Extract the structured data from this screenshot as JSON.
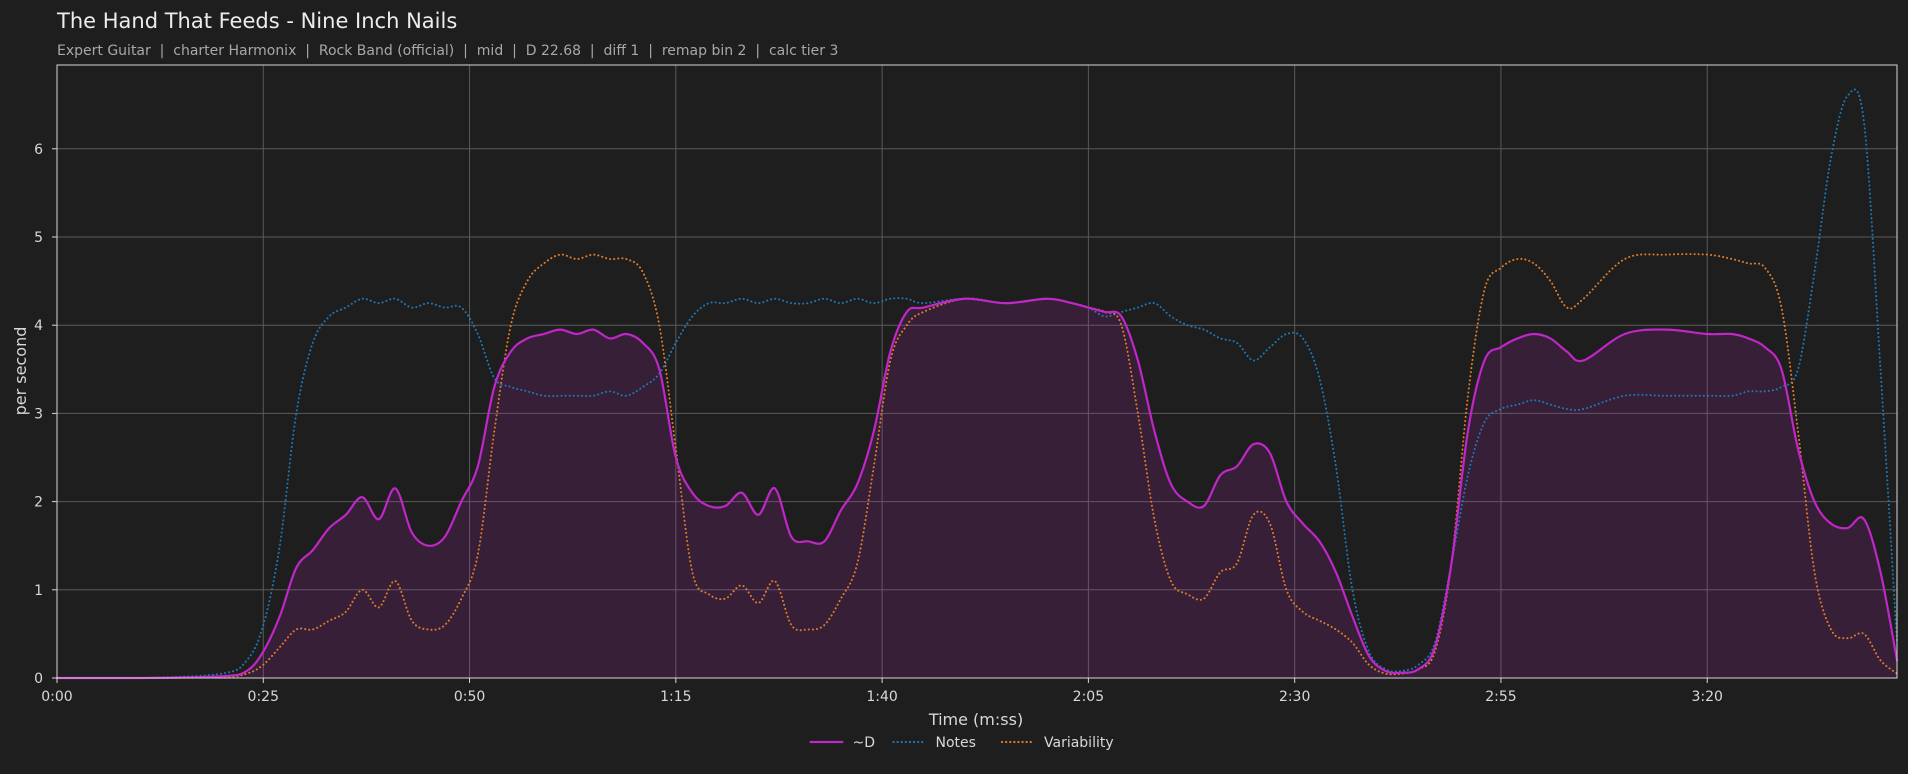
{
  "title": "The Hand That Feeds - Nine Inch Nails",
  "subtitle": "Expert Guitar  |  charter Harmonix  |  Rock Band (official)  |  mid  |  D 22.68  |  diff 1  |  remap bin 2  |  calc tier 3",
  "chart_data": {
    "type": "line",
    "title": "The Hand That Feeds - Nine Inch Nails",
    "xlabel": "Time (m:ss)",
    "ylabel": "per second",
    "xlim": [
      0,
      223
    ],
    "ylim": [
      0,
      6.95
    ],
    "grid": true,
    "legend": "bottom-center",
    "x_ticks": [
      0,
      25,
      50,
      75,
      100,
      125,
      150,
      175,
      200
    ],
    "x_tick_labels": [
      "0:00",
      "0:25",
      "0:50",
      "1:15",
      "1:40",
      "2:05",
      "2:30",
      "2:55",
      "3:20"
    ],
    "y_ticks": [
      0,
      1,
      2,
      3,
      4,
      5,
      6
    ],
    "y_tick_labels": [
      "0",
      "1",
      "2",
      "3",
      "4",
      "5",
      "6"
    ],
    "x": [
      0,
      10,
      20,
      23,
      25,
      27,
      29,
      31,
      33,
      35,
      37,
      39,
      41,
      43,
      45,
      47,
      49,
      51,
      53,
      55,
      57,
      59,
      61,
      63,
      65,
      67,
      69,
      71,
      73,
      75,
      77,
      79,
      81,
      83,
      85,
      87,
      89,
      91,
      93,
      95,
      97,
      99,
      101,
      103,
      105,
      110,
      115,
      120,
      123,
      125,
      127,
      129,
      131,
      133,
      135,
      137,
      139,
      141,
      143,
      145,
      147,
      149,
      151,
      153,
      155,
      157,
      159,
      161,
      163,
      165,
      167,
      169,
      171,
      173,
      175,
      177,
      179,
      181,
      183,
      185,
      190,
      195,
      200,
      203,
      205,
      207,
      209,
      211,
      213,
      215,
      217,
      219,
      221,
      223
    ],
    "series": [
      {
        "name": "~D",
        "color": "#c026c8",
        "style": "solid",
        "values": [
          0,
          0,
          0.02,
          0.08,
          0.3,
          0.7,
          1.25,
          1.45,
          1.7,
          1.85,
          2.05,
          1.8,
          2.15,
          1.65,
          1.5,
          1.6,
          2.0,
          2.4,
          3.3,
          3.7,
          3.85,
          3.9,
          3.95,
          3.9,
          3.95,
          3.85,
          3.9,
          3.8,
          3.5,
          2.5,
          2.1,
          1.95,
          1.95,
          2.1,
          1.85,
          2.15,
          1.6,
          1.55,
          1.55,
          1.9,
          2.2,
          2.8,
          3.7,
          4.15,
          4.2,
          4.3,
          4.25,
          4.3,
          4.25,
          4.2,
          4.15,
          4.1,
          3.6,
          2.8,
          2.2,
          2.0,
          1.95,
          2.3,
          2.4,
          2.65,
          2.55,
          2.0,
          1.75,
          1.55,
          1.2,
          0.7,
          0.25,
          0.08,
          0.06,
          0.1,
          0.35,
          1.3,
          2.8,
          3.6,
          3.75,
          3.85,
          3.9,
          3.85,
          3.7,
          3.6,
          3.9,
          3.95,
          3.9,
          3.9,
          3.85,
          3.75,
          3.5,
          2.6,
          2.0,
          1.75,
          1.7,
          1.8,
          1.2,
          0.2
        ]
      },
      {
        "name": "Notes",
        "color": "#1f77b4",
        "style": "dotted",
        "values": [
          0,
          0,
          0.05,
          0.2,
          0.6,
          1.5,
          3.0,
          3.8,
          4.1,
          4.2,
          4.3,
          4.25,
          4.3,
          4.2,
          4.25,
          4.2,
          4.2,
          3.9,
          3.4,
          3.3,
          3.25,
          3.2,
          3.2,
          3.2,
          3.2,
          3.25,
          3.2,
          3.3,
          3.45,
          3.8,
          4.1,
          4.25,
          4.25,
          4.3,
          4.25,
          4.3,
          4.25,
          4.25,
          4.3,
          4.25,
          4.3,
          4.25,
          4.3,
          4.3,
          4.25,
          4.3,
          4.25,
          4.3,
          4.25,
          4.2,
          4.1,
          4.15,
          4.2,
          4.25,
          4.1,
          4.0,
          3.95,
          3.85,
          3.8,
          3.6,
          3.75,
          3.9,
          3.85,
          3.4,
          2.4,
          1.0,
          0.3,
          0.1,
          0.08,
          0.15,
          0.4,
          1.3,
          2.3,
          2.9,
          3.05,
          3.1,
          3.15,
          3.1,
          3.05,
          3.05,
          3.2,
          3.2,
          3.2,
          3.2,
          3.25,
          3.25,
          3.3,
          3.5,
          4.6,
          5.9,
          6.6,
          6.3,
          3.5,
          0.4
        ]
      },
      {
        "name": "Variability",
        "color": "#e07b2a",
        "style": "dotted",
        "values": [
          0,
          0,
          0.01,
          0.05,
          0.15,
          0.35,
          0.55,
          0.55,
          0.65,
          0.75,
          1.0,
          0.8,
          1.1,
          0.65,
          0.55,
          0.6,
          0.9,
          1.4,
          2.8,
          4.0,
          4.5,
          4.7,
          4.8,
          4.75,
          4.8,
          4.75,
          4.75,
          4.6,
          4.0,
          2.6,
          1.2,
          0.95,
          0.9,
          1.05,
          0.85,
          1.1,
          0.6,
          0.55,
          0.6,
          0.9,
          1.3,
          2.4,
          3.6,
          4.0,
          4.15,
          4.3,
          4.25,
          4.3,
          4.25,
          4.2,
          4.15,
          4.0,
          3.0,
          1.8,
          1.1,
          0.95,
          0.9,
          1.2,
          1.3,
          1.85,
          1.75,
          1.0,
          0.75,
          0.65,
          0.55,
          0.4,
          0.15,
          0.05,
          0.05,
          0.1,
          0.3,
          1.3,
          3.2,
          4.4,
          4.65,
          4.75,
          4.7,
          4.5,
          4.2,
          4.3,
          4.75,
          4.8,
          4.8,
          4.75,
          4.7,
          4.65,
          4.2,
          2.8,
          1.2,
          0.55,
          0.45,
          0.5,
          0.2,
          0.05
        ]
      }
    ]
  }
}
